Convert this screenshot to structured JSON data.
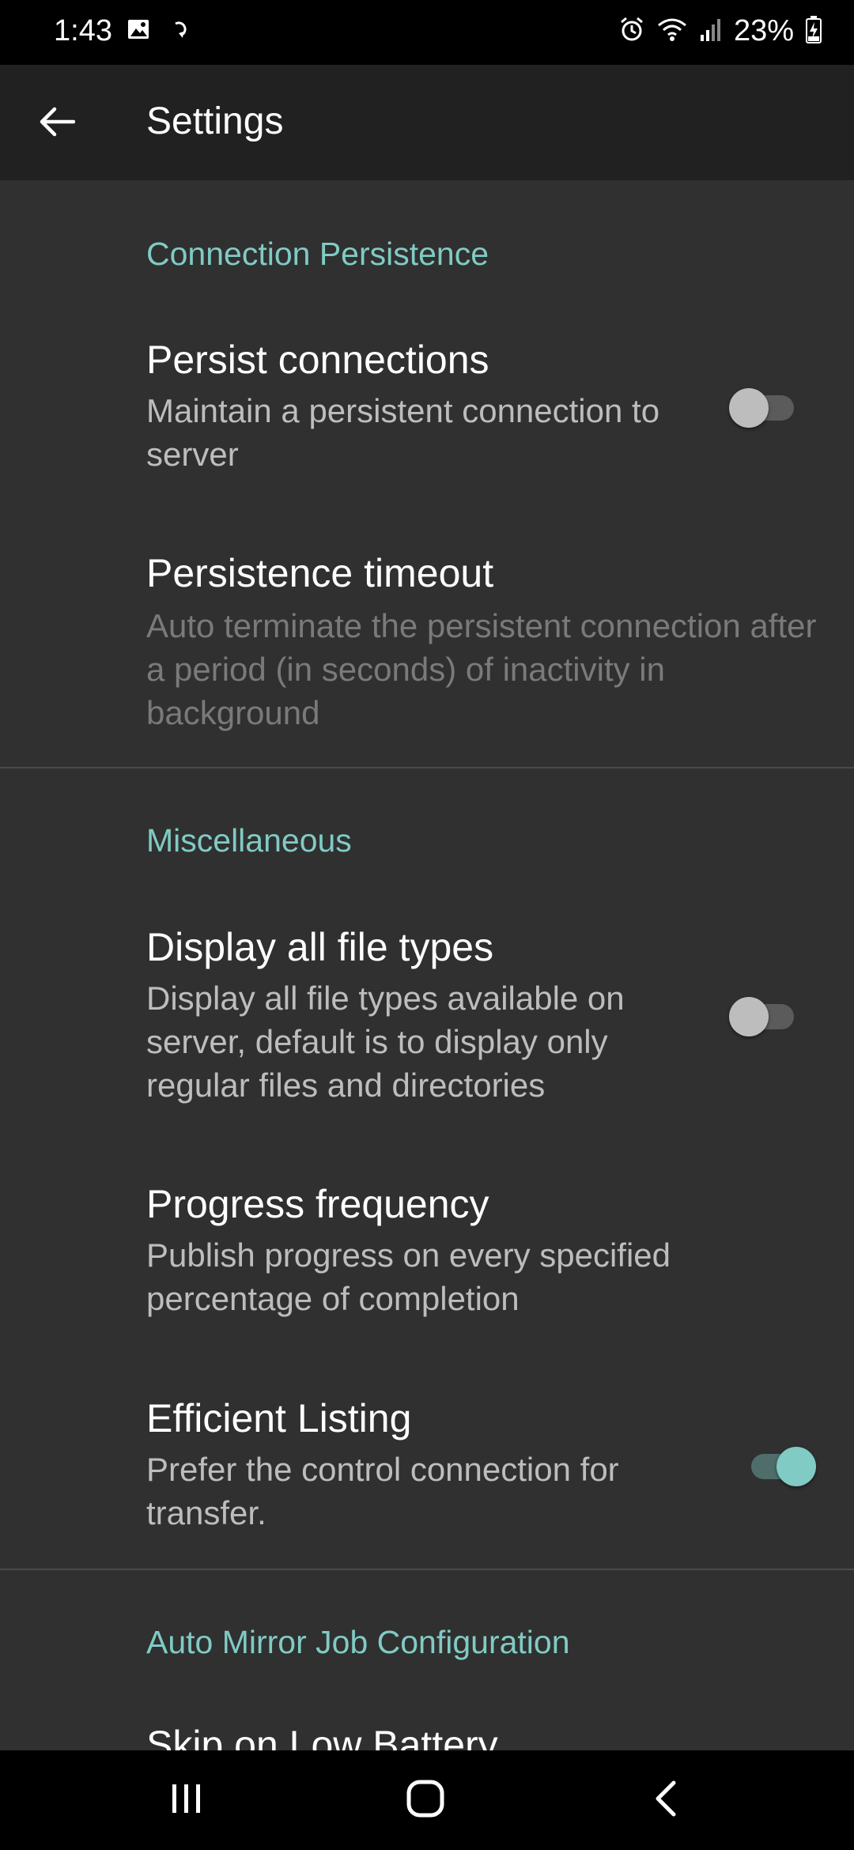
{
  "status_bar": {
    "time": "1:43",
    "battery": "23%",
    "icons": [
      "image-icon",
      "sync-icon",
      "alarm-icon",
      "wifi-icon",
      "signal-icon",
      "battery-charging-icon"
    ]
  },
  "app_bar": {
    "title": "Settings",
    "back_icon": "arrow-back-icon"
  },
  "sections": [
    {
      "header": "Connection Persistence",
      "items": [
        {
          "title": "Persist connections",
          "summary": "Maintain a persistent connection to server",
          "switch": false
        },
        {
          "title": "Persistence timeout",
          "summary": "Auto terminate the persistent connection after a period (in seconds) of inactivity in background",
          "disabled": true
        }
      ]
    },
    {
      "header": "Miscellaneous",
      "items": [
        {
          "title": "Display all file types",
          "summary": "Display all file types available on server, default is to display only regular files and directories",
          "switch": false
        },
        {
          "title": "Progress frequency",
          "summary": "Publish progress on every specified percentage of completion"
        },
        {
          "title": "Efficient Listing",
          "summary": "Prefer the control connection for transfer.",
          "switch": true
        }
      ]
    },
    {
      "header": "Auto Mirror Job Configuration",
      "items": [
        {
          "title": "Skip on Low Battery"
        }
      ]
    }
  ],
  "colors": {
    "accent": "#80cbc4",
    "background": "#303030",
    "app_bar": "#212121",
    "summary_text": "#bdbdbd",
    "disabled_text": "#7a7a7a"
  },
  "nav_bar": {
    "icons": [
      "recent-apps-icon",
      "home-icon",
      "back-icon"
    ]
  }
}
